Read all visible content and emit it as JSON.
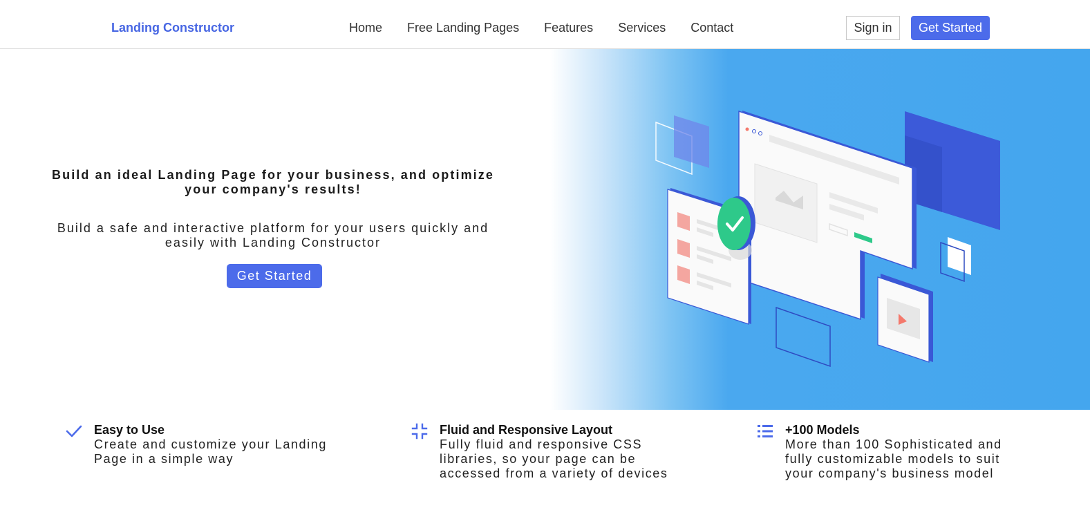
{
  "header": {
    "brand": "Landing Constructor",
    "nav": [
      "Home",
      "Free Landing Pages",
      "Features",
      "Services",
      "Contact"
    ],
    "sign_in": "Sign in",
    "get_started": "Get Started"
  },
  "hero": {
    "title": "Build an ideal Landing Page for your business, and optimize your company's results!",
    "subtitle": "Build a safe and interactive platform for your users quickly and easily with Landing Constructor",
    "cta": "Get Started"
  },
  "features": [
    {
      "icon": "check-icon",
      "title": "Easy to Use",
      "description": "Create and customize your Landing Page in a simple way"
    },
    {
      "icon": "compress-icon",
      "title": "Fluid and Responsive Layout",
      "description": "Fully fluid and responsive CSS libraries, so your page can be accessed from a variety of devices"
    },
    {
      "icon": "list-icon",
      "title": "+100 Models",
      "description": "More than 100 Sophisticated and fully customizable models to suit your company's business model"
    }
  ],
  "colors": {
    "accent": "#4c6bea",
    "hero_background": "#44a6ee",
    "success": "#2ec98a",
    "placeholder_red": "#f4a6a0"
  }
}
